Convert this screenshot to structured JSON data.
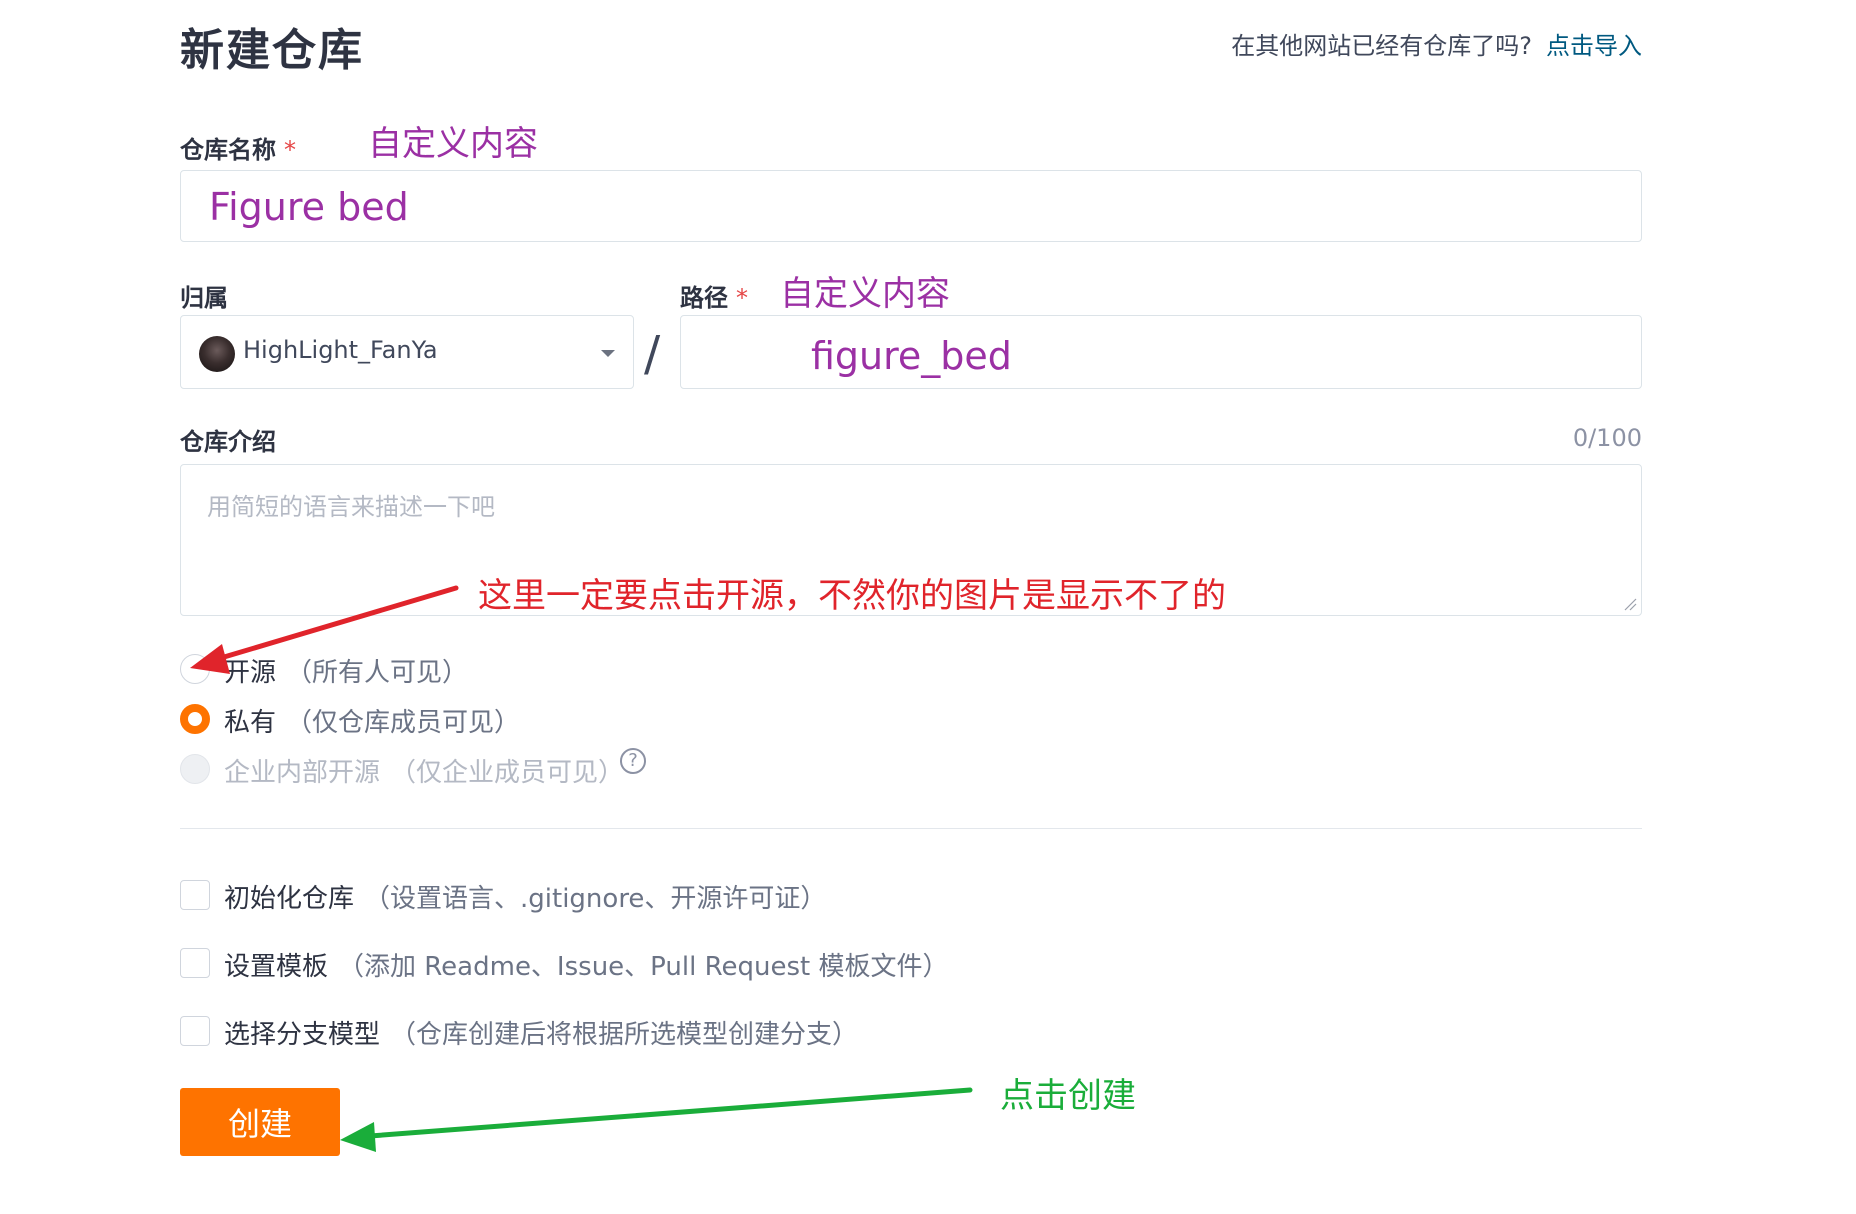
{
  "header": {
    "title": "新建仓库",
    "import_prompt": "在其他网站已经有仓库了吗?",
    "import_link": "点击导入"
  },
  "repo_name": {
    "label": "仓库名称",
    "required_mark": "*",
    "value": "Figure bed",
    "annotation": "自定义内容"
  },
  "owner": {
    "label": "归属",
    "value": "HighLight_FanYa"
  },
  "path": {
    "label": "路径",
    "required_mark": "*",
    "value": "figure_bed",
    "annotation": "自定义内容",
    "separator": "/"
  },
  "description": {
    "label": "仓库介绍",
    "counter": "0/100",
    "placeholder": "用简短的语言来描述一下吧",
    "annotation": "这里一定要点击开源，不然你的图片是显示不了的"
  },
  "visibility": {
    "options": [
      {
        "label": "开源",
        "hint": "（所有人可见）",
        "state": "unchecked"
      },
      {
        "label": "私有",
        "hint": "（仅仓库成员可见）",
        "state": "checked"
      },
      {
        "label": "企业内部开源",
        "hint": "（仅企业成员可见）",
        "state": "disabled"
      }
    ],
    "help_glyph": "?"
  },
  "options": [
    {
      "label": "初始化仓库",
      "hint": "（设置语言、.gitignore、开源许可证）"
    },
    {
      "label": "设置模板",
      "hint": "（添加 Readme、Issue、Pull Request 模板文件）"
    },
    {
      "label": "选择分支模型",
      "hint": "（仓库创建后将根据所选模型创建分支）"
    }
  ],
  "submit": {
    "label": "创建",
    "annotation": "点击创建"
  },
  "colors": {
    "accent": "#fe7300",
    "annotation_purple": "#9b30a4",
    "annotation_red": "#e0242b",
    "annotation_green": "#1aad3a",
    "link": "#005980"
  }
}
